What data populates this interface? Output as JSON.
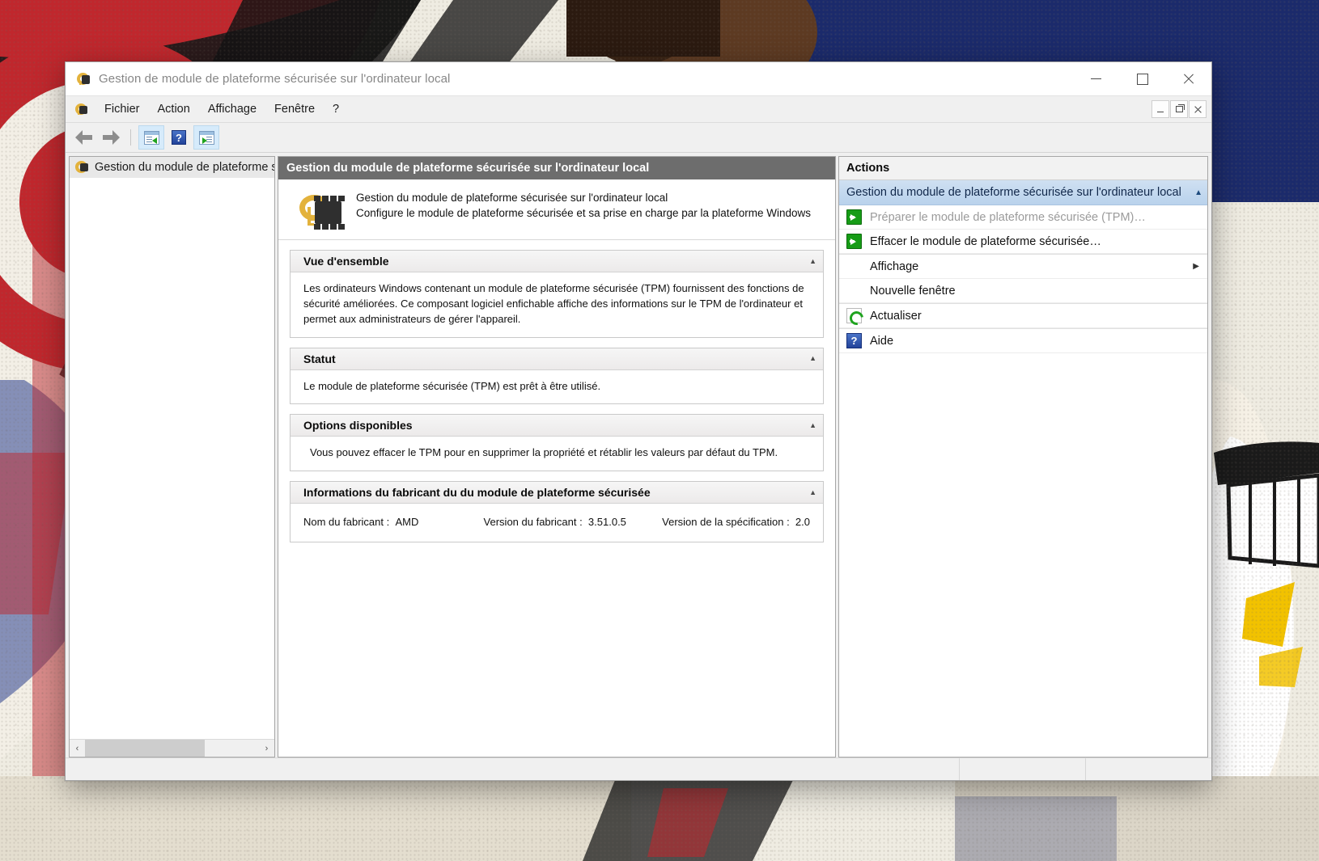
{
  "window": {
    "title": "Gestion de module de plateforme sécurisée sur l'ordinateur local",
    "title_icon": "tpm-icon",
    "controls": {
      "minimize": "minimize-icon",
      "maximize": "maximize-icon",
      "close": "close-icon"
    },
    "mdi_controls": {
      "minimize": "mdi-minimize-icon",
      "restore": "mdi-restore-icon",
      "close": "mdi-close-icon"
    }
  },
  "menubar": {
    "icon": "tpm-icon",
    "items": [
      "Fichier",
      "Action",
      "Affichage",
      "Fenêtre",
      "?"
    ]
  },
  "toolbar": {
    "items": [
      {
        "name": "back-arrow-icon",
        "label": "Précédent"
      },
      {
        "name": "forward-arrow-icon",
        "label": "Suivant"
      },
      {
        "name": "show-hide-tree-icon",
        "label": "Afficher/Masquer l'arborescence",
        "active": true
      },
      {
        "name": "help-icon",
        "label": "Aide",
        "active": false
      },
      {
        "name": "show-hide-action-pane-icon",
        "label": "Afficher/Masquer le volet Actions",
        "active": true
      }
    ]
  },
  "tree": {
    "items": [
      {
        "label": "Gestion du module de plateforme s",
        "icon": "tpm-icon",
        "selected": true
      }
    ],
    "hscroll": {
      "left_arrow": "‹",
      "right_arrow": "›"
    }
  },
  "center": {
    "title": "Gestion du module de plateforme sécurisée sur l'ordinateur local",
    "hero": {
      "icon": "tpm-key-chip-icon",
      "line1": "Gestion du module de plateforme sécurisée sur l'ordinateur local",
      "line2": "Configure le module de plateforme sécurisée et sa prise en charge par la plateforme Windows"
    },
    "sections": [
      {
        "title": "Vue d'ensemble",
        "collapse_icon": "chevron-up-icon",
        "body": "Les ordinateurs Windows contenant un module de plateforme sécurisée (TPM) fournissent des fonctions de sécurité améliorées. Ce composant logiciel enfichable affiche des informations sur le TPM de l'ordinateur et permet aux administrateurs de gérer l'appareil."
      },
      {
        "title": "Statut",
        "collapse_icon": "chevron-up-icon",
        "body": "Le module de plateforme sécurisée (TPM) est prêt à être utilisé."
      },
      {
        "title": "Options disponibles",
        "collapse_icon": "chevron-up-icon",
        "body": "Vous pouvez effacer le TPM pour en supprimer la propriété et rétablir les valeurs par défaut du TPM."
      }
    ],
    "manufacturer": {
      "title": "Informations du fabricant du du module de plateforme sécurisée",
      "collapse_icon": "chevron-up-icon",
      "fields": [
        {
          "label": "Nom du fabricant :",
          "value": "AMD"
        },
        {
          "label": "Version du fabricant :",
          "value": "3.51.0.5"
        },
        {
          "label": "Version de la spécification :",
          "value": "2.0"
        }
      ]
    }
  },
  "actions": {
    "title": "Actions",
    "group": {
      "label": "Gestion du module de plateforme sécurisée sur l'ordinateur local",
      "collapse_icon": "chevron-up-icon"
    },
    "items": [
      {
        "label": "Préparer le module de plateforme sécurisée (TPM)…",
        "icon": "green-arrow-icon",
        "disabled": true,
        "submenu": false
      },
      {
        "label": "Effacer le module de plateforme sécurisée…",
        "icon": "green-arrow-icon",
        "disabled": false,
        "submenu": false
      },
      {
        "label": "Affichage",
        "icon": null,
        "disabled": false,
        "submenu": true,
        "submenu_icon": "chevron-right-icon"
      },
      {
        "label": "Nouvelle fenêtre",
        "icon": null,
        "disabled": false,
        "submenu": false
      },
      {
        "label": "Actualiser",
        "icon": "refresh-icon",
        "disabled": false,
        "submenu": false
      },
      {
        "label": "Aide",
        "icon": "help-icon",
        "disabled": false,
        "submenu": false
      }
    ]
  },
  "statusbar": {
    "text": ""
  },
  "colors": {
    "title_gray": "#868686",
    "center_header_bg": "#6d6d6d",
    "action_group_bg": "#c3d8ee",
    "green_accent": "#169c16",
    "help_blue": "#22439a",
    "key_gold": "#e3b23c"
  }
}
